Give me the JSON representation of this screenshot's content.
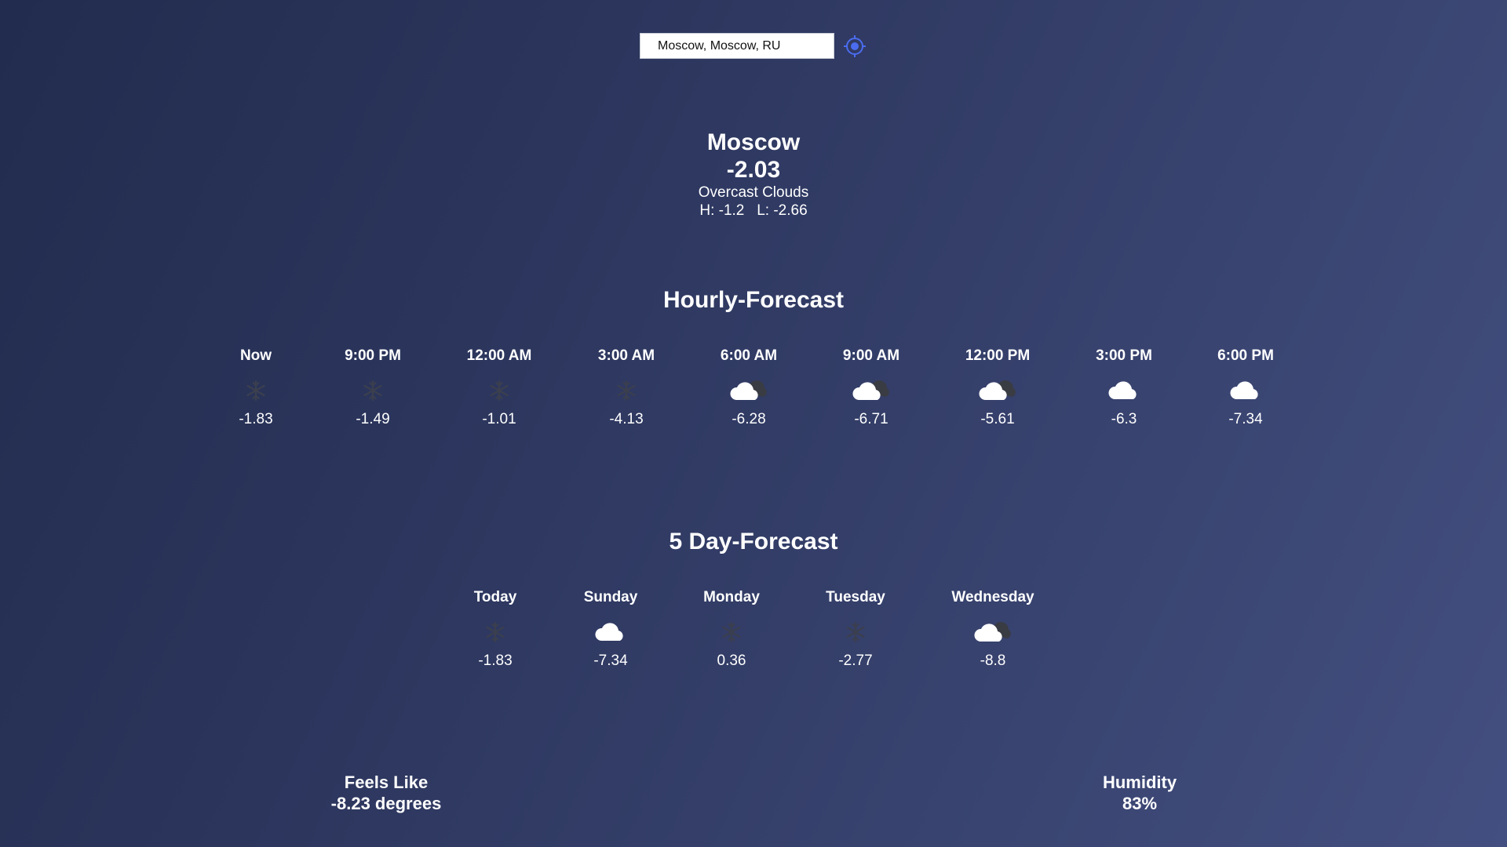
{
  "search": {
    "value": "Moscow, Moscow, RU"
  },
  "current": {
    "city": "Moscow",
    "temp": "-2.03",
    "description": "Overcast Clouds",
    "hilo": "H: -1.2   L: -2.66"
  },
  "hourly": {
    "title": "Hourly-Forecast",
    "items": [
      {
        "label": "Now",
        "icon": "snow-icon",
        "value": "-1.83"
      },
      {
        "label": "9:00 PM",
        "icon": "snow-icon",
        "value": "-1.49"
      },
      {
        "label": "12:00 AM",
        "icon": "snow-icon",
        "value": "-1.01"
      },
      {
        "label": "3:00 AM",
        "icon": "snow-icon",
        "value": "-4.13"
      },
      {
        "label": "6:00 AM",
        "icon": "broken-clouds-icon",
        "value": "-6.28"
      },
      {
        "label": "9:00 AM",
        "icon": "broken-clouds-icon",
        "value": "-6.71"
      },
      {
        "label": "12:00 PM",
        "icon": "broken-clouds-icon",
        "value": "-5.61"
      },
      {
        "label": "3:00 PM",
        "icon": "cloud-icon",
        "value": "-6.3"
      },
      {
        "label": "6:00 PM",
        "icon": "cloud-icon",
        "value": "-7.34"
      }
    ]
  },
  "daily": {
    "title": "5 Day-Forecast",
    "items": [
      {
        "label": "Today",
        "icon": "snow-icon",
        "value": "-1.83"
      },
      {
        "label": "Sunday",
        "icon": "cloud-icon",
        "value": "-7.34"
      },
      {
        "label": "Monday",
        "icon": "snow-icon",
        "value": "0.36"
      },
      {
        "label": "Tuesday",
        "icon": "snow-icon",
        "value": "-2.77"
      },
      {
        "label": "Wednesday",
        "icon": "broken-clouds-icon",
        "value": "-8.8"
      }
    ]
  },
  "feels_like": {
    "label": "Feels Like",
    "value": "-8.23 degrees"
  },
  "humidity": {
    "label": "Humidity",
    "value": "83%"
  },
  "colors": {
    "locate_icon": "#4b6cf0",
    "snow_icon": "#3b3f4e",
    "cloud_white": "#ffffff",
    "cloud_dark": "#3a3c44"
  }
}
